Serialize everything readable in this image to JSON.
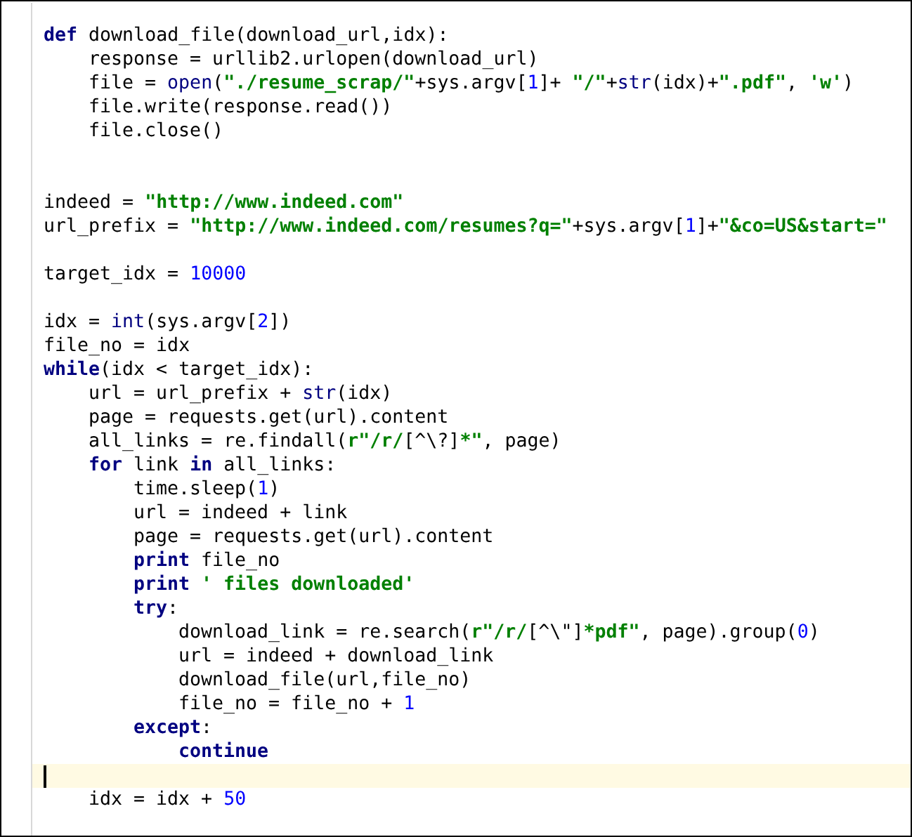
{
  "lines": [
    {
      "current": false,
      "tokens": [
        {
          "kind": "kw",
          "text": "def"
        },
        {
          "kind": "plain",
          "text": " download_file(download_url,idx):"
        }
      ],
      "children": [
        {
          "current": false,
          "tokens": [
            {
              "kind": "plain",
              "text": "response = urllib2.urlopen(download_url)"
            }
          ]
        },
        {
          "current": false,
          "tokens": [
            {
              "kind": "plain",
              "text": "file = "
            },
            {
              "kind": "builtin",
              "text": "open"
            },
            {
              "kind": "plain",
              "text": "("
            },
            {
              "kind": "str",
              "text": "\"./resume_scrap/\""
            },
            {
              "kind": "plain",
              "text": "+sys.argv["
            },
            {
              "kind": "num",
              "text": "1"
            },
            {
              "kind": "plain",
              "text": "]+ "
            },
            {
              "kind": "str",
              "text": "\"/\""
            },
            {
              "kind": "plain",
              "text": "+"
            },
            {
              "kind": "builtin",
              "text": "str"
            },
            {
              "kind": "plain",
              "text": "(idx)+"
            },
            {
              "kind": "str",
              "text": "\".pdf\""
            },
            {
              "kind": "plain",
              "text": ", "
            },
            {
              "kind": "str",
              "text": "'w'"
            },
            {
              "kind": "plain",
              "text": ")"
            }
          ]
        },
        {
          "current": false,
          "tokens": [
            {
              "kind": "plain",
              "text": "file.write(response.read())"
            }
          ]
        },
        {
          "current": false,
          "tokens": [
            {
              "kind": "plain",
              "text": "file.close()"
            }
          ]
        }
      ]
    },
    {
      "current": false
    },
    {
      "current": false
    },
    {
      "current": false,
      "tokens": [
        {
          "kind": "plain",
          "text": "indeed = "
        },
        {
          "kind": "str",
          "text": "\"http://www.indeed.com\""
        }
      ]
    },
    {
      "current": false,
      "tokens": [
        {
          "kind": "plain",
          "text": "url_prefix = "
        },
        {
          "kind": "str",
          "text": "\"http://www.indeed.com/resumes?q=\""
        },
        {
          "kind": "plain",
          "text": "+sys.argv["
        },
        {
          "kind": "num",
          "text": "1"
        },
        {
          "kind": "plain",
          "text": "]+"
        },
        {
          "kind": "str",
          "text": "\"&co=US&start=\""
        }
      ]
    },
    {
      "current": false
    },
    {
      "current": false,
      "tokens": [
        {
          "kind": "plain",
          "text": "target_idx = "
        },
        {
          "kind": "num",
          "text": "10000"
        }
      ]
    },
    {
      "current": false
    },
    {
      "current": false,
      "tokens": [
        {
          "kind": "plain",
          "text": "idx = "
        },
        {
          "kind": "builtin",
          "text": "int"
        },
        {
          "kind": "plain",
          "text": "(sys.argv["
        },
        {
          "kind": "num",
          "text": "2"
        },
        {
          "kind": "plain",
          "text": "])"
        }
      ]
    },
    {
      "current": false,
      "tokens": [
        {
          "kind": "plain",
          "text": "file_no = idx"
        }
      ]
    },
    {
      "current": false,
      "tokens": [
        {
          "kind": "kw",
          "text": "while"
        },
        {
          "kind": "plain",
          "text": "(idx < target_idx):"
        }
      ],
      "children": [
        {
          "current": false,
          "tokens": [
            {
              "kind": "plain",
              "text": "url = url_prefix + "
            },
            {
              "kind": "builtin",
              "text": "str"
            },
            {
              "kind": "plain",
              "text": "(idx)"
            }
          ]
        },
        {
          "current": false,
          "tokens": [
            {
              "kind": "plain",
              "text": "page = requests.get(url).content"
            }
          ]
        },
        {
          "current": false,
          "tokens": [
            {
              "kind": "plain",
              "text": "all_links = re.findall("
            },
            {
              "kind": "str",
              "text": "r\"/r/"
            },
            {
              "kind": "plain",
              "text": "[^\\?]"
            },
            {
              "kind": "str",
              "text": "*\""
            },
            {
              "kind": "plain",
              "text": ", page)"
            }
          ]
        },
        {
          "current": false,
          "tokens": [
            {
              "kind": "kw",
              "text": "for"
            },
            {
              "kind": "plain",
              "text": " link "
            },
            {
              "kind": "kw",
              "text": "in"
            },
            {
              "kind": "plain",
              "text": " all_links:"
            }
          ],
          "children": [
            {
              "current": false,
              "tokens": [
                {
                  "kind": "plain",
                  "text": "time.sleep("
                },
                {
                  "kind": "num",
                  "text": "1"
                },
                {
                  "kind": "plain",
                  "text": ")"
                }
              ]
            },
            {
              "current": false,
              "tokens": [
                {
                  "kind": "plain",
                  "text": "url = indeed + link"
                }
              ]
            },
            {
              "current": false,
              "tokens": [
                {
                  "kind": "plain",
                  "text": "page = requests.get(url).content"
                }
              ]
            },
            {
              "current": false,
              "tokens": [
                {
                  "kind": "kw",
                  "text": "print"
                },
                {
                  "kind": "plain",
                  "text": " file_no"
                }
              ]
            },
            {
              "current": false,
              "tokens": [
                {
                  "kind": "kw",
                  "text": "print"
                },
                {
                  "kind": "str",
                  "text": " ' files downloaded'"
                }
              ]
            },
            {
              "current": false,
              "tokens": [
                {
                  "kind": "kw",
                  "text": "try"
                },
                {
                  "kind": "plain",
                  "text": ":"
                }
              ],
              "children": [
                {
                  "current": false,
                  "tokens": [
                    {
                      "kind": "plain",
                      "text": "download_link = re.search("
                    },
                    {
                      "kind": "str",
                      "text": "r\"/r/"
                    },
                    {
                      "kind": "plain",
                      "text": "[^\\\"]"
                    },
                    {
                      "kind": "str",
                      "text": "*pdf\""
                    },
                    {
                      "kind": "plain",
                      "text": ", page).group("
                    },
                    {
                      "kind": "num",
                      "text": "0"
                    },
                    {
                      "kind": "plain",
                      "text": ")"
                    }
                  ]
                },
                {
                  "current": false,
                  "tokens": [
                    {
                      "kind": "plain",
                      "text": "url = indeed + download_link"
                    }
                  ]
                },
                {
                  "current": false,
                  "tokens": [
                    {
                      "kind": "plain",
                      "text": "download_file(url,file_no)"
                    }
                  ]
                },
                {
                  "current": false,
                  "tokens": [
                    {
                      "kind": "plain",
                      "text": "file_no = file_no + "
                    },
                    {
                      "kind": "num",
                      "text": "1"
                    }
                  ]
                }
              ]
            },
            {
              "current": false,
              "tokens": [
                {
                  "kind": "kw",
                  "text": "except"
                },
                {
                  "kind": "plain",
                  "text": ":"
                }
              ],
              "children": [
                {
                  "current": false,
                  "tokens": [
                    {
                      "kind": "kw",
                      "text": "continue"
                    }
                  ]
                }
              ]
            }
          ]
        },
        {
          "current": true
        },
        {
          "current": false,
          "tokens": [
            {
              "kind": "plain",
              "text": "idx = idx + "
            },
            {
              "kind": "num",
              "text": "50"
            }
          ]
        }
      ]
    }
  ]
}
